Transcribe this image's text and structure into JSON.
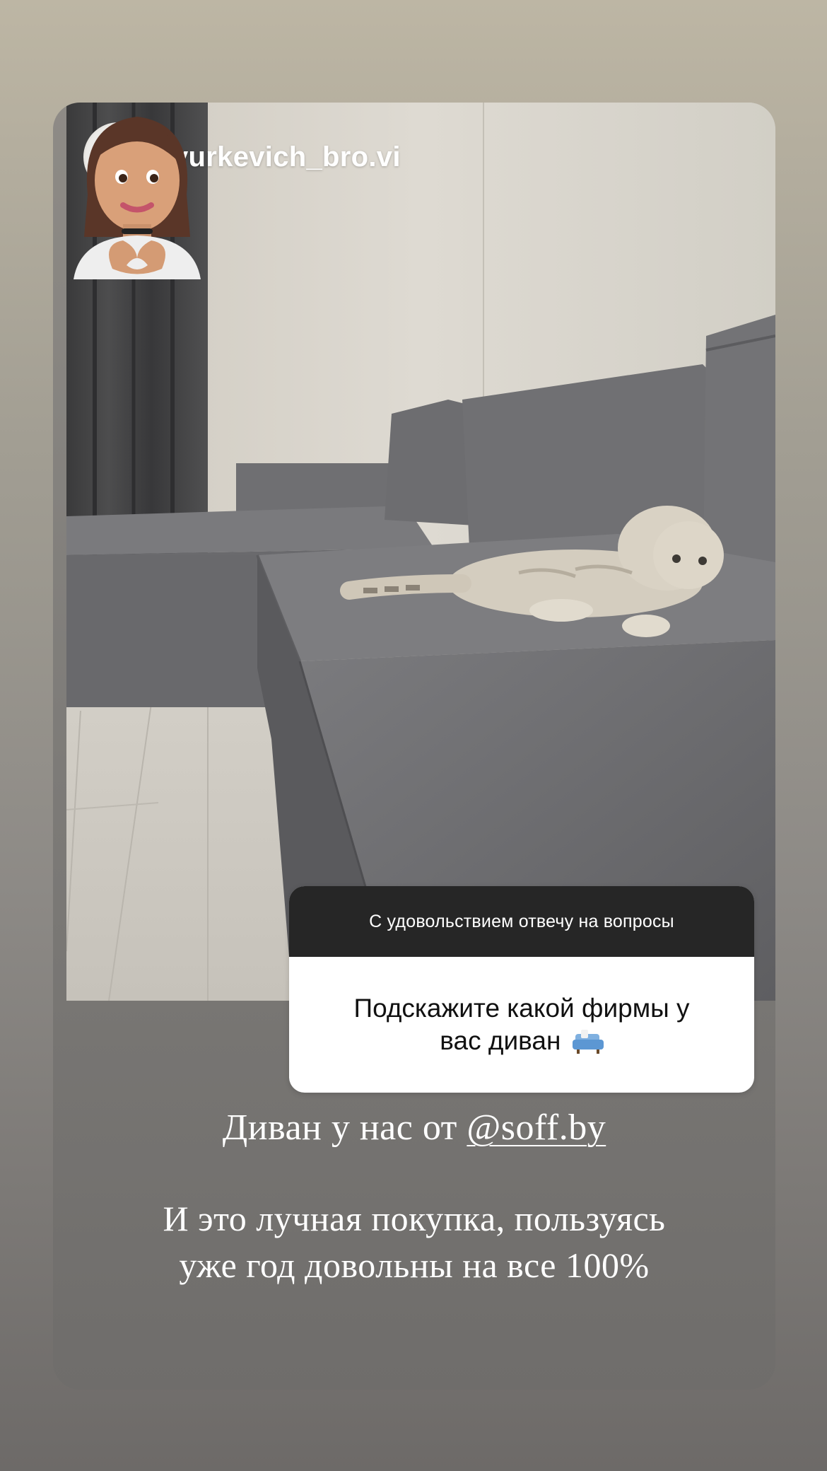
{
  "story": {
    "username": "yurkevich_bro.vi",
    "avatar_icon": "avatar-photo",
    "photo_icon": "sofa-with-cat-photo",
    "sticker_icon": "memoji-heart-hands-sticker"
  },
  "question_sticker": {
    "header": "С удовольствием отвечу на вопросы",
    "question_line1": "Подскажите какой фирмы у",
    "question_line2": "вас диван",
    "emoji_icon": "couch-icon"
  },
  "caption": {
    "line1_prefix": "Диван у нас от ",
    "mention": "@soff.by",
    "line2": "И это лучная покупка, пользуясь",
    "line3": "уже год довольны на все 100%"
  },
  "colors": {
    "sticker_header_bg": "#262626",
    "sofa": "#6b6b6d"
  }
}
